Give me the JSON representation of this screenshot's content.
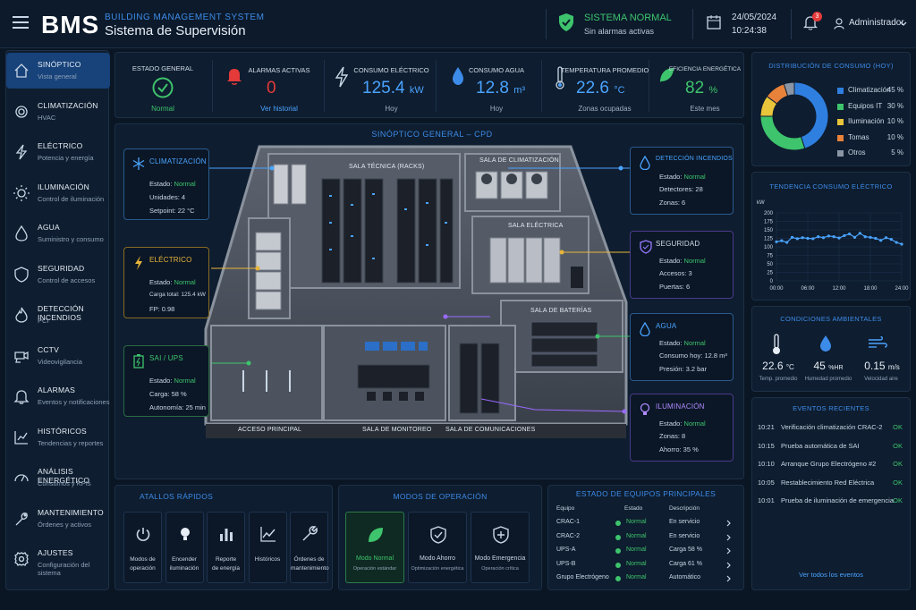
{
  "header": {
    "logo": "BMS",
    "brand_line1": "BUILDING MANAGEMENT SYSTEM",
    "brand_line2": "Sistema de Supervisión",
    "status_title": "SISTEMA NORMAL",
    "status_sub": "Sin alarmas activas",
    "date": "24/05/2024",
    "time": "10:24:38",
    "notifications": "3",
    "user": "Administrador"
  },
  "sidebar": [
    {
      "label": "SINÓPTICO",
      "sub": "Vista general",
      "icon": "home-icon",
      "active": true
    },
    {
      "label": "CLIMATIZACIÓN",
      "sub": "HVAC",
      "icon": "gear-icon"
    },
    {
      "label": "ELÉCTRICO",
      "sub": "Potencia y energía",
      "icon": "lightning-icon"
    },
    {
      "label": "ILUMINACIÓN",
      "sub": "Control de iluminación",
      "icon": "sun-icon"
    },
    {
      "label": "AGUA",
      "sub": "Suministro y consumo",
      "icon": "drop-icon"
    },
    {
      "label": "SEGURIDAD",
      "sub": "Control de accesos",
      "icon": "shield-icon"
    },
    {
      "label": "DETECCIÓN INCENDIOS",
      "sub": "PCI",
      "icon": "flame-icon"
    },
    {
      "label": "CCTV",
      "sub": "Videovigilancia",
      "icon": "camera-icon"
    },
    {
      "label": "ALARMAS",
      "sub": "Eventos y notificaciones",
      "icon": "bell-icon"
    },
    {
      "label": "HISTÓRICOS",
      "sub": "Tendencias y reportes",
      "icon": "chart-icon"
    },
    {
      "label": "ANÁLISIS ENERGÉTICO",
      "sub": "Consumos y KPIs",
      "icon": "gauge-icon"
    },
    {
      "label": "MANTENIMIENTO",
      "sub": "Órdenes y activos",
      "icon": "wrench-icon"
    },
    {
      "label": "AJUSTES",
      "sub": "Configuración del sistema",
      "icon": "settings-icon"
    }
  ],
  "kpis": {
    "estado": {
      "title": "ESTADO GENERAL",
      "sub": "Normal"
    },
    "alarmas": {
      "title": "ALARMAS ACTIVAS",
      "value": "0",
      "sub": "Ver historial"
    },
    "electrico": {
      "title": "CONSUMO ELÉCTRICO",
      "value": "125.4",
      "unit": "kW",
      "sub": "Hoy"
    },
    "agua": {
      "title": "CONSUMO AGUA",
      "value": "12.8",
      "unit": "m³",
      "sub": "Hoy"
    },
    "temp": {
      "title": "TEMPERATURA PROMEDIO",
      "value": "22.6",
      "unit": "°C",
      "sub": "Zonas ocupadas"
    },
    "eficiencia": {
      "title": "EFICIENCIA ENERGÉTICA",
      "value": "82",
      "unit": "%",
      "sub": "Este mes"
    }
  },
  "synoptic": {
    "title": "SINÓPTICO GENERAL – CPD",
    "rooms": {
      "racks": "SALA TÉCNICA (RACKS)",
      "clima": "SALA DE CLIMATIZACIÓN",
      "electrica": "SALA ELÉCTRICA",
      "baterias": "SALA DE BATERÍAS",
      "acceso": "ACCESO PRINCIPAL",
      "monitoreo": "SALA DE MONITOREO",
      "comunicaciones": "SALA DE COMUNICACIONES"
    },
    "cards": {
      "clima": {
        "title": "CLIMATIZACIÓN",
        "r1": "Estado:",
        "v1": "Normal",
        "r2": "Unidades:  4",
        "r3": "Setpoint:  22 °C"
      },
      "elec": {
        "title": "ELÉCTRICO",
        "r1": "Estado:",
        "v1": "Normal",
        "r2": "Carga total: 125.4 kW",
        "r3": "FP:  0.98"
      },
      "ups": {
        "title": "SAI / UPS",
        "r1": "Estado:",
        "v1": "Normal",
        "r2": "Carga:  58 %",
        "r3": "Autonomía:  25 min"
      },
      "fire": {
        "title": "DETECCIÓN INCENDIOS",
        "r1": "Estado:",
        "v1": "Normal",
        "r2": "Detectores:  28",
        "r3": "Zonas:  6"
      },
      "sec": {
        "title": "SEGURIDAD",
        "r1": "Estado:",
        "v1": "Normal",
        "r2": "Accesos:  3",
        "r3": "Puertas:  6"
      },
      "water": {
        "title": "AGUA",
        "r1": "Estado:",
        "v1": "Normal",
        "r2": "Consumo hoy:  12.8 m³",
        "r3": "Presión:  3.2 bar"
      },
      "light": {
        "title": "ILUMINACIÓN",
        "r1": "Estado:",
        "v1": "Normal",
        "r2": "Zonas:  8",
        "r3": "Ahorro:  35 %"
      }
    }
  },
  "quick": {
    "title": "ATALLOS RÁPIDOS",
    "items": [
      {
        "l1": "Modos de",
        "l2": "operación",
        "icon": "power-icon"
      },
      {
        "l1": "Encender",
        "l2": "iluminación",
        "icon": "bulb-icon"
      },
      {
        "l1": "Reporte",
        "l2": "de energía",
        "icon": "bar-chart-icon"
      },
      {
        "l1": "Históricos",
        "l2": "",
        "icon": "line-chart-icon"
      },
      {
        "l1": "Órdenes de",
        "l2": "mantenimiento",
        "icon": "wrench-icon"
      }
    ]
  },
  "modes": {
    "title": "MODOS DE OPERACIÓN",
    "items": [
      {
        "label": "Modo Normal",
        "sub": "Operación estándar",
        "icon": "leaf-icon"
      },
      {
        "label": "Modo Ahorro",
        "sub": "Optimización energética",
        "icon": "shield-check-icon"
      },
      {
        "label": "Modo Emergencia",
        "sub": "Operación crítica",
        "icon": "shield-plus-icon"
      }
    ]
  },
  "equipment": {
    "title": "ESTADO DE EQUIPOS PRINCIPALES",
    "headers": [
      "Equipo",
      "Estado",
      "Descripción"
    ],
    "rows": [
      {
        "name": "CRAC-1",
        "state": "Normal",
        "desc": "En servicio"
      },
      {
        "name": "CRAC-2",
        "state": "Normal",
        "desc": "En servicio"
      },
      {
        "name": "UPS-A",
        "state": "Normal",
        "desc": "Carga 58 %"
      },
      {
        "name": "UPS-B",
        "state": "Normal",
        "desc": "Carga 61 %"
      },
      {
        "name": "Grupo Electrógeno",
        "state": "Normal",
        "desc": "Automático"
      }
    ]
  },
  "distribution": {
    "title": "DISTRIBUCIÓN DE CONSUMO (HOY)"
  },
  "trend": {
    "title": "TENDENCIA CONSUMO ELÉCTRICO",
    "unit": "kW"
  },
  "ambient": {
    "title": "CONDICIONES AMBIENTALES",
    "temp": {
      "value": "22.6",
      "unit": "°C",
      "label": "Temp. promedio"
    },
    "hum": {
      "value": "45",
      "unit": "%HR",
      "label": "Humedad promedio"
    },
    "wind": {
      "value": "0.15",
      "unit": "m/s",
      "label": "Velocidad aire"
    }
  },
  "events": {
    "title": "EVENTOS RECIENTES",
    "items": [
      {
        "time": "10:21",
        "text": "Verificación climatización CRAC-2",
        "state": "OK"
      },
      {
        "time": "10:15",
        "text": "Prueba automática de SAI",
        "state": "OK"
      },
      {
        "time": "10:10",
        "text": "Arranque Grupo Electrógeno #2",
        "state": "OK"
      },
      {
        "time": "10:05",
        "text": "Restablecimiento Red Eléctrica",
        "state": "OK"
      },
      {
        "time": "10:01",
        "text": "Prueba de iluminación de emergencia",
        "state": "OK"
      }
    ],
    "link": "Ver todos los eventos"
  },
  "chart_data": [
    {
      "type": "pie",
      "title": "DISTRIBUCIÓN DE CONSUMO (HOY)",
      "categories": [
        "Climatización",
        "Equipos IT",
        "Iluminación",
        "Tomas",
        "Otros"
      ],
      "values": [
        45,
        30,
        10,
        10,
        5
      ],
      "colors": [
        "#2f7fe0",
        "#3ec46d",
        "#e8c53a",
        "#e8823a",
        "#8a96a6"
      ]
    },
    {
      "type": "line",
      "title": "TENDENCIA CONSUMO ELÉCTRICO",
      "ylabel": "kW",
      "x": [
        "00:00",
        "01:00",
        "02:00",
        "03:00",
        "04:00",
        "05:00",
        "06:00",
        "07:00",
        "08:00",
        "09:00",
        "10:00",
        "11:00",
        "12:00",
        "13:00",
        "14:00",
        "15:00",
        "16:00",
        "17:00",
        "18:00",
        "19:00",
        "20:00",
        "21:00",
        "22:00",
        "23:00",
        "24:00"
      ],
      "xticks": [
        "00:00",
        "06:00",
        "12:00",
        "18:00",
        "24:00"
      ],
      "values": [
        115,
        118,
        113,
        128,
        124,
        127,
        125,
        124,
        130,
        127,
        132,
        130,
        126,
        133,
        138,
        128,
        140,
        130,
        128,
        125,
        119,
        127,
        122,
        113,
        108
      ],
      "ylim": [
        0,
        200
      ],
      "yticks": [
        0,
        25,
        50,
        75,
        100,
        125,
        150,
        175,
        200
      ],
      "color": "#4aa3ff"
    }
  ]
}
